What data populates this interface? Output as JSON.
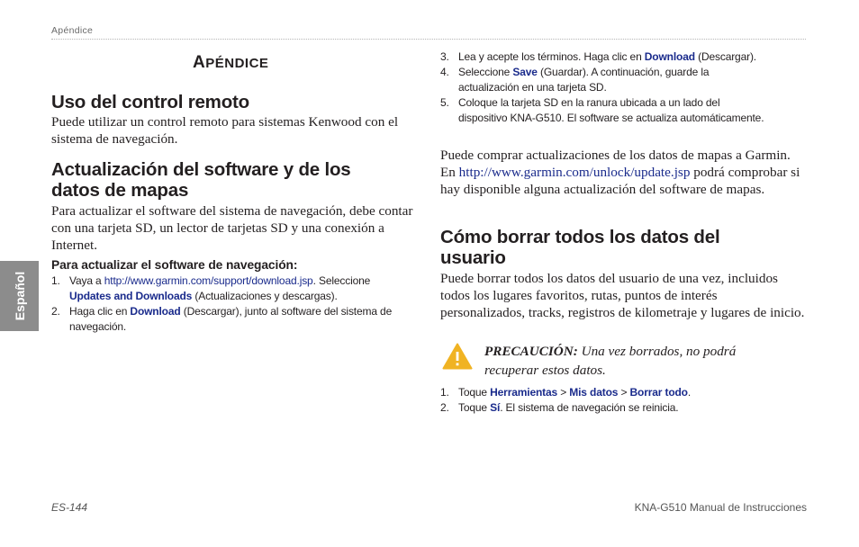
{
  "header": {
    "running_title": "Apéndice"
  },
  "side_tab": {
    "label": "Español"
  },
  "section": {
    "title_initial": "A",
    "title_rest": "PÉNDICE"
  },
  "remote": {
    "heading": "Uso del control remoto",
    "body": "Puede utilizar un control remoto para sistemas Kenwood con el sistema de navegación."
  },
  "update": {
    "heading_line1": "Actualización del software y de los",
    "heading_line2": "datos de mapas",
    "body": "Para actualizar el software del sistema de navegación, debe contar con una tarjeta SD, un lector de tarjetas SD y una conexión a Internet.",
    "procedure_heading": "Para actualizar el software de navegación:",
    "steps": [
      {
        "num": "1.",
        "t1": "Vaya a ",
        "link": "http://www.garmin.com/support/download.jsp",
        "t2": ". Seleccione ",
        "kw": "Updates and Downloads",
        "t3": " (Actualizaciones y descargas)."
      },
      {
        "num": "2.",
        "t1": "Haga clic en ",
        "kw": "Download",
        "t2": " (Descargar), junto al software del sistema de navegación."
      },
      {
        "num": "3.",
        "t1": "Lea y acepte los términos. Haga clic en ",
        "kw": "Download",
        "t2": " (Descargar)."
      },
      {
        "num": "4.",
        "t1": "Seleccione ",
        "kw": "Save",
        "t2": " (Guardar). A continuación, guarde la actualización en una tarjeta SD."
      },
      {
        "num": "5.",
        "t1": "Coloque la tarjeta SD en la ranura ubicada a un lado del dispositivo KNA-G510. El software se actualiza automáticamente."
      }
    ],
    "maps_t1": "Puede comprar actualizaciones de los datos de mapas a Garmin. En ",
    "maps_link": "http://www.garmin.com/unlock/update.jsp",
    "maps_t2": " podrá comprobar si hay disponible alguna actualización del software de mapas."
  },
  "erase": {
    "heading_line1": "Cómo borrar todos los datos del",
    "heading_line2": "usuario",
    "body": "Puede borrar todos los datos del usuario de una vez, incluidos todos los lugares favoritos, rutas, puntos de interés personalizados, tracks, registros de kilometraje y lugares de inicio.",
    "caution_label": "PRECAUCIÓN:",
    "caution_text": " Una vez borrados, no podrá recuperar estos datos.",
    "steps": [
      {
        "num": "1.",
        "t1": "Toque ",
        "kw1": "Herramientas",
        "sep1": " > ",
        "kw2": "Mis datos",
        "sep2": " > ",
        "kw3": "Borrar todo",
        "t2": "."
      },
      {
        "num": "2.",
        "t1": "Toque ",
        "kw1": "Sí",
        "t2": ". El sistema de navegación se reinicia."
      }
    ]
  },
  "footer": {
    "page_number": "ES-144",
    "manual_title": "KNA-G510 Manual de Instrucciones"
  },
  "colors": {
    "keyword": "#1a2b8c",
    "side_tab": "#8c8c8c",
    "caution": "#f0b323"
  },
  "icons": {
    "caution": "warning-triangle-icon"
  }
}
